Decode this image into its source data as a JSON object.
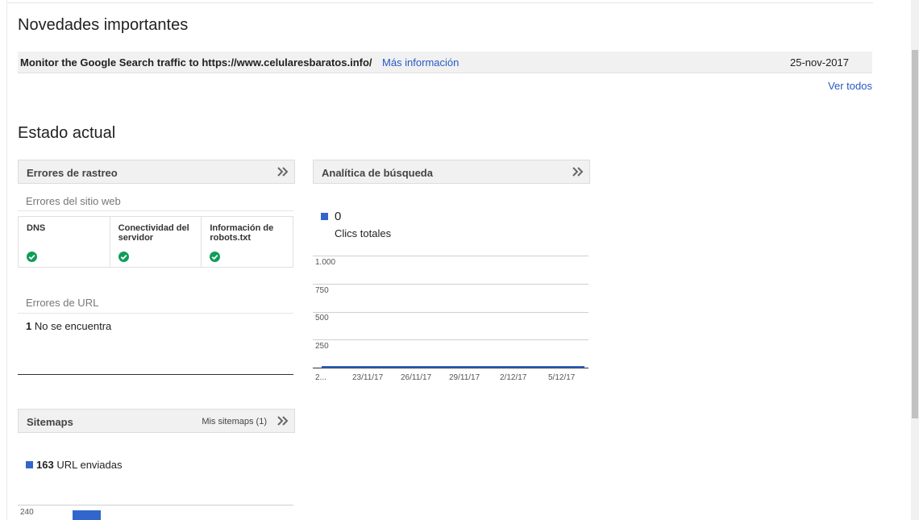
{
  "news": {
    "title": "Novedades importantes",
    "message": "Monitor the Google Search traffic to https://www.celularesbaratos.info/",
    "more_link": "Más información",
    "date": "25-nov-2017",
    "see_all": "Ver todos"
  },
  "status": {
    "title": "Estado actual"
  },
  "crawl_errors": {
    "title": "Errores de rastreo",
    "site_errors_label": "Errores del sitio web",
    "site_errors": [
      {
        "label": "DNS",
        "status": "ok"
      },
      {
        "label": "Conectividad del servidor",
        "status": "ok"
      },
      {
        "label": "Información de robots.txt",
        "status": "ok"
      }
    ],
    "url_errors_label": "Errores de URL",
    "url_errors_count": "1",
    "url_errors_text": "No se encuentra"
  },
  "search_analytics": {
    "title": "Analítica de búsqueda",
    "total_value": "0",
    "total_label": "Clics totales",
    "accent_color": "#3366cc"
  },
  "sitemaps": {
    "title": "Sitemaps",
    "my_sitemaps_link": "Mis sitemaps (1)",
    "submitted_count": "163",
    "submitted_label": "URL enviadas"
  },
  "chart_data": [
    {
      "type": "line",
      "yticks": [
        "1.000",
        "750",
        "500",
        "250"
      ],
      "ylim": [
        0,
        1000
      ],
      "xticks": [
        "2...",
        "23/11/17",
        "26/11/17",
        "29/11/17",
        "2/12/17",
        "5/12/17"
      ],
      "series": [
        {
          "values": [
            0,
            0,
            0,
            0,
            0,
            0
          ]
        }
      ],
      "grid": true
    },
    {
      "type": "bar",
      "yticks": [
        "240"
      ],
      "series": [
        {
          "name": "URL enviadas",
          "values": [
            163
          ]
        }
      ]
    }
  ]
}
